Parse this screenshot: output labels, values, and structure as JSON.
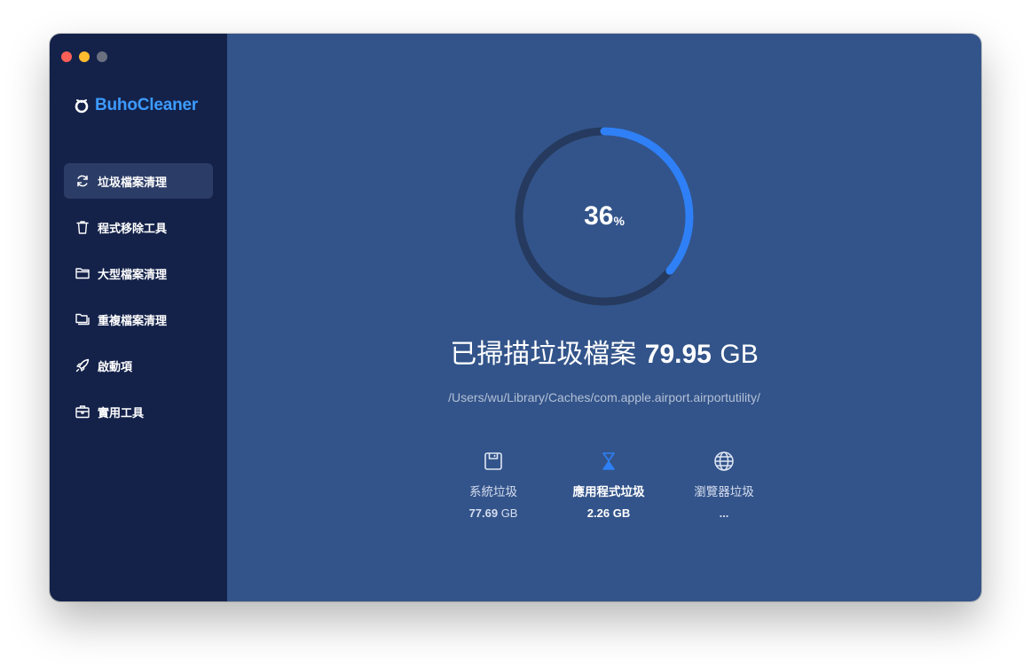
{
  "app": {
    "name": "BuhoCleaner",
    "brand_color": "#3d9bff"
  },
  "window_controls": {
    "close_color": "#fe5f57",
    "minimize_color": "#febc2e",
    "zoom_color": "#6b7080"
  },
  "sidebar": {
    "items": [
      {
        "label": "垃圾檔案清理",
        "icon": "refresh-icon",
        "active": true
      },
      {
        "label": "程式移除工具",
        "icon": "trash-icon",
        "active": false
      },
      {
        "label": "大型檔案清理",
        "icon": "folder-icon",
        "active": false
      },
      {
        "label": "重複檔案清理",
        "icon": "duplicate-folder-icon",
        "active": false
      },
      {
        "label": "啟動項",
        "icon": "rocket-icon",
        "active": false
      },
      {
        "label": "實用工具",
        "icon": "toolbox-icon",
        "active": false
      }
    ]
  },
  "scan": {
    "progress": 36,
    "percent_number": "36",
    "percent_unit": "%",
    "progress_color": "#2f80f6",
    "track_color": "#253a5e",
    "headline_label": "已掃描垃圾檔案",
    "total_size_number": "79.95",
    "total_size_unit": "GB",
    "current_path": "/Users/wu/Library/Caches/com.apple.airport.airportutility/"
  },
  "categories": [
    {
      "label": "系統垃圾",
      "size_number": "77.69",
      "size_unit": "GB",
      "icon": "floppy-disk-icon",
      "active": false
    },
    {
      "label": "應用程式垃圾",
      "size_number": "2.26",
      "size_unit": "GB",
      "icon": "hourglass-icon",
      "active": true
    },
    {
      "label": "瀏覽器垃圾",
      "size_text": "...",
      "icon": "globe-icon",
      "active": false
    }
  ]
}
